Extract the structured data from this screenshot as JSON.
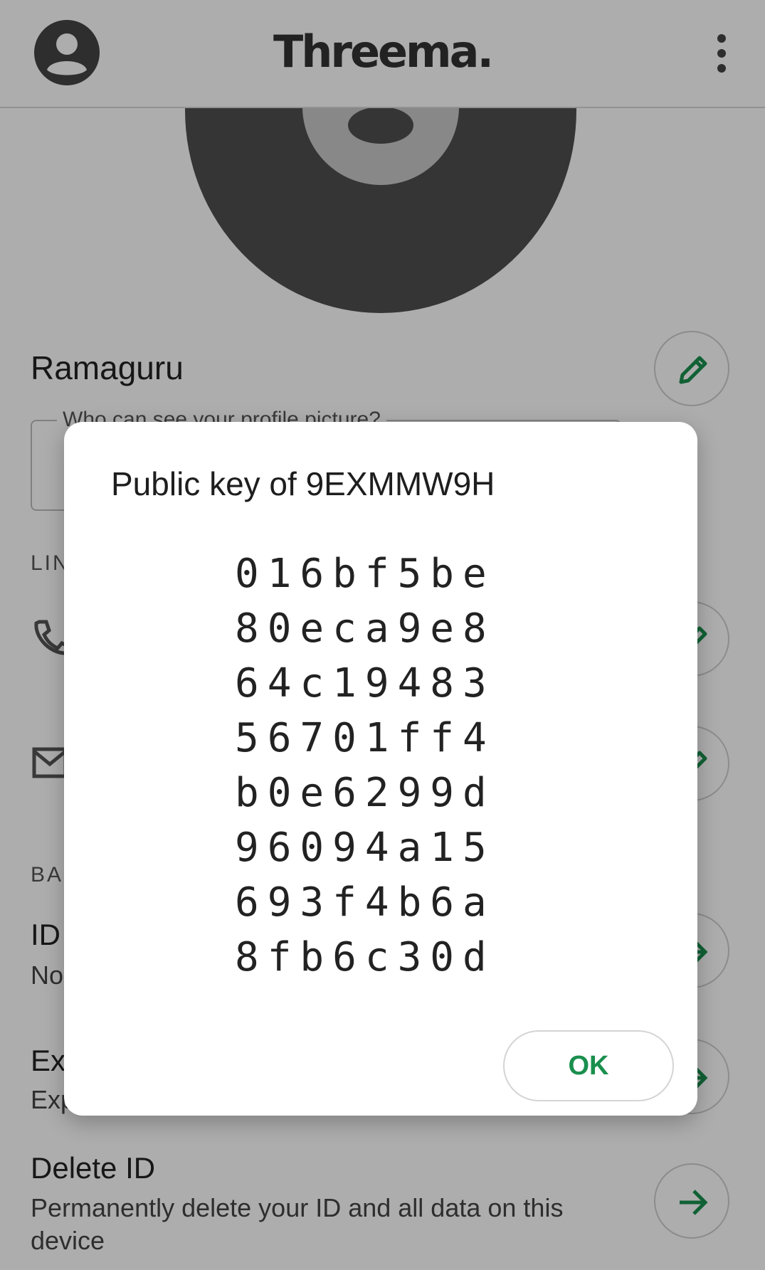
{
  "appbar": {
    "brand": "Threema.",
    "avatar_icon": "account-circle-icon",
    "menu_icon": "more-vertical-icon"
  },
  "profile": {
    "name": "Ramaguru",
    "visibility_label": "Who can see your profile picture?",
    "camera_icon": "camera-icon",
    "edit_icon": "pencil-icon"
  },
  "sections": {
    "linked_label": "LIN",
    "backup_label": "BA"
  },
  "items": {
    "id_title": "ID",
    "id_sub": "No",
    "export_title": "Ex",
    "export_sub": "Exp",
    "delete_title": "Delete ID",
    "delete_sub": "Permanently delete your ID and all data on this device"
  },
  "dialog": {
    "title": "Public key of 9EXMMW9H",
    "key_lines": [
      "016bf5be",
      "80eca9e8",
      "64c19483",
      "56701ff4",
      "b0e6299d",
      "96094a15",
      "693f4b6a",
      "8fb6c30d"
    ],
    "ok_label": "OK"
  },
  "colors": {
    "accent": "#1a8f4e",
    "scrim": "rgba(0,0,0,0.32)",
    "photo_placeholder": "#4f4f4f"
  }
}
